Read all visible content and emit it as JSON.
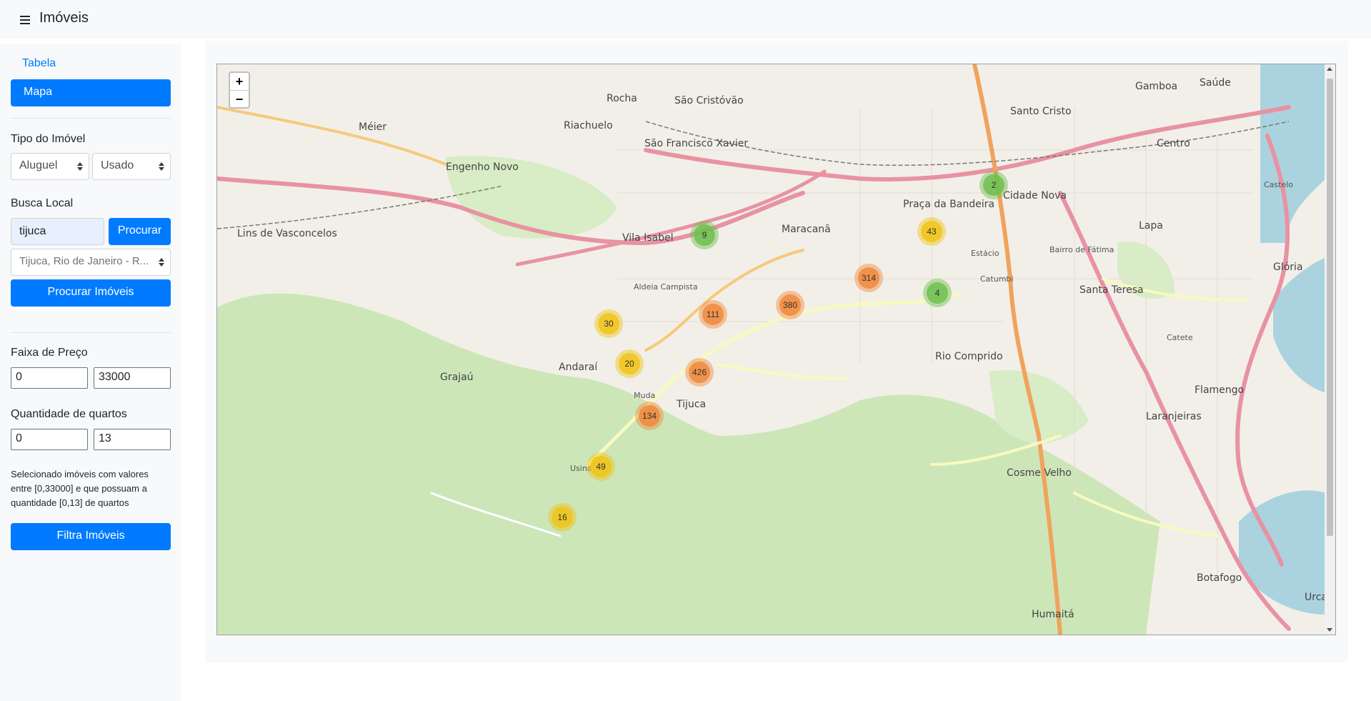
{
  "header": {
    "title": "Imóveis"
  },
  "sidebar": {
    "link_tabela": "Tabela",
    "link_mapa": "Mapa",
    "tipo_label": "Tipo do Imóvel",
    "tipo_select": "Aluguel",
    "condicao_select": "Usado",
    "busca_label": "Busca Local",
    "busca_value": "tijuca",
    "procurar_button": "Procurar",
    "local_select": "Tijuca, Rio de Janeiro - R...",
    "procurar_imoveis_button": "Procurar Imóveis",
    "faixa_label": "Faixa de Preço",
    "price_min": "0",
    "price_max": "33000",
    "quartos_label": "Quantidade de quartos",
    "rooms_min": "0",
    "rooms_max": "13",
    "note": "Selecionado imóveis com valores entre [0,33000] e que possuam a quantidade [0,13] de quartos",
    "filtra_button": "Filtra Imóveis"
  },
  "map": {
    "zoom_in": "+",
    "zoom_out": "−",
    "places": [
      "São Cristóvão",
      "Santo Cristo",
      "Gamboa",
      "Saúde",
      "Centro",
      "Rocha",
      "Riachuelo",
      "Méier",
      "Engenho Novo",
      "São Francisco Xavier",
      "Maracanã",
      "Praça da Bandeira",
      "Cidade Nova",
      "Estácio",
      "Lapa",
      "Bairro de Fátima",
      "Glória",
      "Catumbi",
      "Santa Teresa",
      "Vila Isabel",
      "Aldeia Campista",
      "Andaraí",
      "Grajaú",
      "Lins de Vasconcelos",
      "Rio Comprido",
      "Tijuca",
      "Muda",
      "Usina",
      "Cosme Velho",
      "Laranjeiras",
      "Flamengo",
      "Catete",
      "Botafogo",
      "Humaitá",
      "Urca",
      "Castelo"
    ],
    "colors": {
      "small": "#6fbf4f",
      "medium": "#f0c419",
      "large": "#f08a3c",
      "park": "#cde6b8"
    },
    "clusters": [
      {
        "count": "2",
        "size": "small"
      },
      {
        "count": "43",
        "size": "medium"
      },
      {
        "count": "9",
        "size": "small"
      },
      {
        "count": "314",
        "size": "large"
      },
      {
        "count": "4",
        "size": "small"
      },
      {
        "count": "380",
        "size": "large"
      },
      {
        "count": "111",
        "size": "large"
      },
      {
        "count": "30",
        "size": "medium"
      },
      {
        "count": "20",
        "size": "medium"
      },
      {
        "count": "426",
        "size": "large"
      },
      {
        "count": "134",
        "size": "large"
      },
      {
        "count": "49",
        "size": "medium"
      },
      {
        "count": "16",
        "size": "medium"
      }
    ]
  }
}
